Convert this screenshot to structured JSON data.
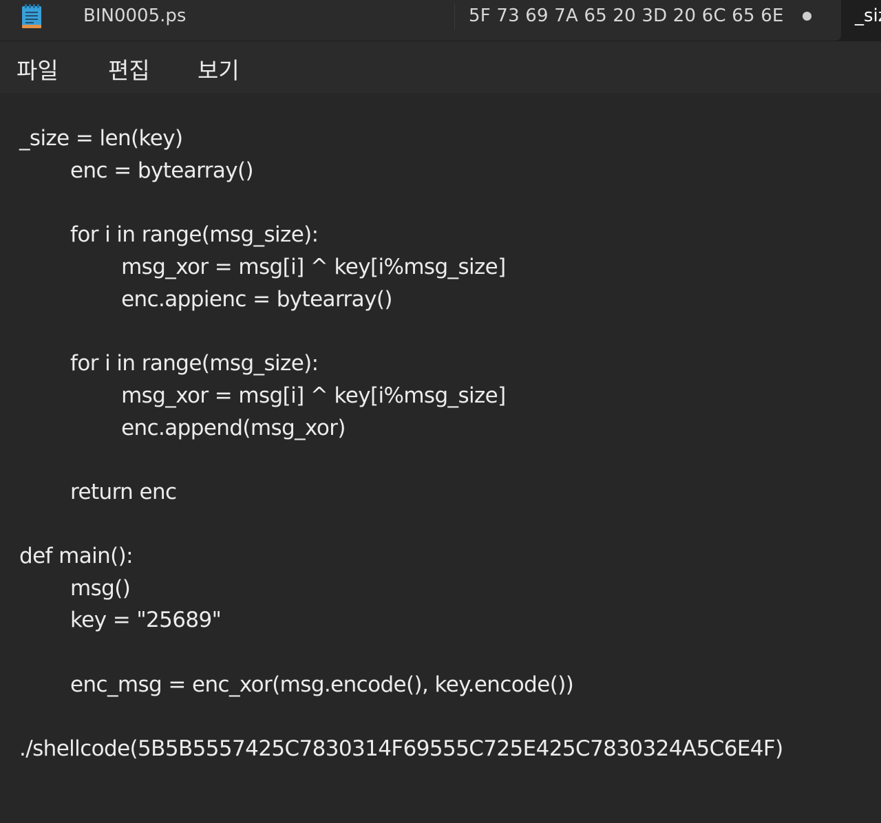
{
  "titlebar": {
    "app_icon": "notepad-icon",
    "tabs": [
      {
        "label": "BIN0005.ps"
      },
      {
        "label": "5F 73 69 7A 65 20 3D 20 6C 65 6E",
        "modified_dot": "●"
      },
      {
        "label": "_size"
      }
    ]
  },
  "menu": {
    "items": [
      "파일",
      "편집",
      "보기"
    ]
  },
  "editor": {
    "lines": [
      "_size = len(key)",
      "        enc = bytearray()",
      "",
      "        for i in range(msg_size):",
      "                msg_xor = msg[i] ^ key[i%msg_size]",
      "                enc.appienc = bytearray()",
      "",
      "        for i in range(msg_size):",
      "                msg_xor = msg[i] ^ key[i%msg_size]",
      "                enc.append(msg_xor)",
      "",
      "        return enc",
      "",
      "def main():",
      "        msg()",
      "        key = \"25689\"",
      "",
      "        enc_msg = enc_xor(msg.encode(), key.encode())",
      "",
      "./shellcode(5B5B5557425C7830314F69555C725E425C7830324A5C6E4F)"
    ]
  },
  "colors": {
    "background": "#272727",
    "titlebar": "#1e1e1e",
    "active_tab": "#2b2b2b",
    "text": "#ececec",
    "icon_accent": "#3aa0d8"
  }
}
